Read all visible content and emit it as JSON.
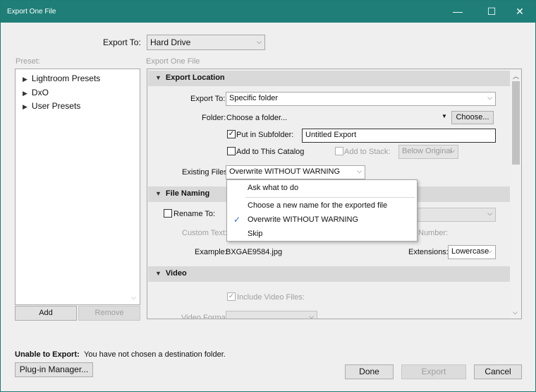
{
  "window": {
    "title": "Export One File",
    "minimize": "—",
    "maximize": "☐",
    "close": "✕"
  },
  "top": {
    "export_to_label": "Export To:",
    "export_to_value": "Hard Drive"
  },
  "preset": {
    "label": "Preset:",
    "items": [
      "Lightroom Presets",
      "DxO",
      "User Presets"
    ],
    "add_label": "Add",
    "remove_label": "Remove"
  },
  "main_label": "Export One File",
  "export_location": {
    "header": "Export Location",
    "export_to_label": "Export To:",
    "export_to_value": "Specific folder",
    "folder_label": "Folder:",
    "folder_value": "Choose a folder...",
    "choose_label": "Choose...",
    "subfolder_label": "Put in Subfolder:",
    "subfolder_checked": true,
    "subfolder_value": "Untitled Export",
    "catalog_label": "Add to This Catalog",
    "stack_label": "Add to Stack:",
    "stack_value": "Below Original",
    "existing_label": "Existing Files:",
    "existing_value": "Overwrite WITHOUT WARNING"
  },
  "existing_menu": {
    "items": [
      "Ask what to do",
      "Choose a new name for the exported file",
      "Overwrite WITHOUT WARNING",
      "Skip"
    ],
    "selected": "Overwrite WITHOUT WARNING",
    "check": "✓"
  },
  "file_naming": {
    "header": "File Naming",
    "rename_label": "Rename To:",
    "custom_text_label": "Custom Text:",
    "start_number_label": "Number:",
    "example_label": "Example:",
    "example_value": "BXGAE9584.jpg",
    "extensions_label": "Extensions:",
    "extensions_value": "Lowercase"
  },
  "video": {
    "header": "Video",
    "include_label": "Include Video Files:",
    "format_label": "Video Format:"
  },
  "footer": {
    "unable_label": "Unable to Export:",
    "unable_message": "You have not chosen a destination folder.",
    "plugin_label": "Plug-in Manager...",
    "done_label": "Done",
    "export_label": "Export",
    "cancel_label": "Cancel"
  }
}
